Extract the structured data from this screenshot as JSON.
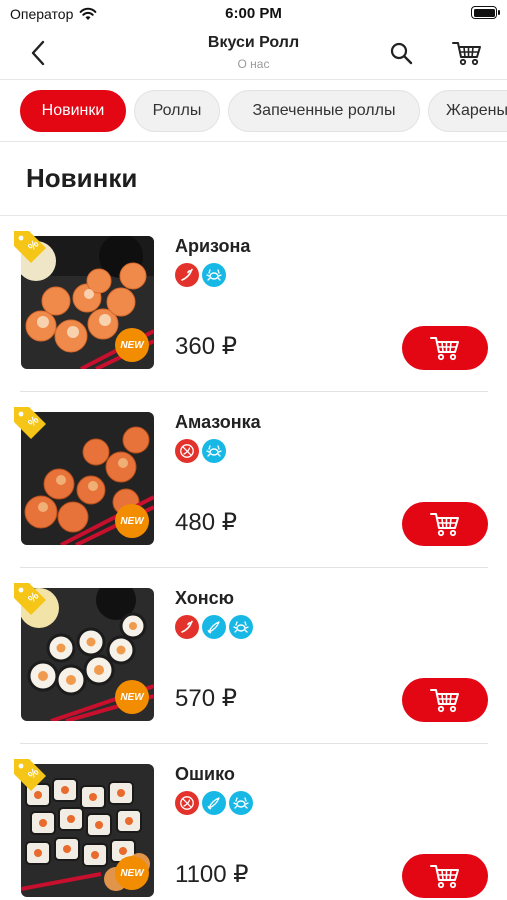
{
  "status_bar": {
    "carrier": "Оператор",
    "time": "6:00 PM"
  },
  "nav": {
    "title": "Вкуси Ролл",
    "subtitle": "О нас"
  },
  "categories": [
    {
      "label": "Новинки",
      "active": true
    },
    {
      "label": "Роллы",
      "active": false
    },
    {
      "label": "Запеченные роллы",
      "active": false
    },
    {
      "label": "Жарены",
      "active": false
    }
  ],
  "section": {
    "title": "Новинки"
  },
  "products": [
    {
      "name": "Аризона",
      "price": "360 ₽",
      "badges": [
        "sale-icon",
        "new-badge"
      ],
      "new_label": "NEW",
      "tags": [
        "spicy-icon",
        "crab-icon"
      ]
    },
    {
      "name": "Амазонка",
      "price": "480 ₽",
      "badges": [
        "sale-icon",
        "new-badge"
      ],
      "new_label": "NEW",
      "tags": [
        "not-spicy-icon",
        "crab-icon"
      ]
    },
    {
      "name": "Хонсю",
      "price": "570 ₽",
      "badges": [
        "sale-icon",
        "new-badge"
      ],
      "new_label": "NEW",
      "tags": [
        "spicy-icon",
        "fish-icon",
        "crab-icon"
      ]
    },
    {
      "name": "Ошико",
      "price": "1100 ₽",
      "badges": [
        "sale-icon",
        "new-badge"
      ],
      "new_label": "NEW",
      "tags": [
        "not-spicy-icon",
        "fish-icon",
        "crab-icon"
      ]
    }
  ],
  "colors": {
    "accent": "#e30613",
    "chip_bg": "#f1f1f1",
    "tag_red": "#e3322b",
    "tag_blue": "#17b8e6",
    "new_badge": "#f28c00",
    "sale_tag": "#f5c518"
  }
}
